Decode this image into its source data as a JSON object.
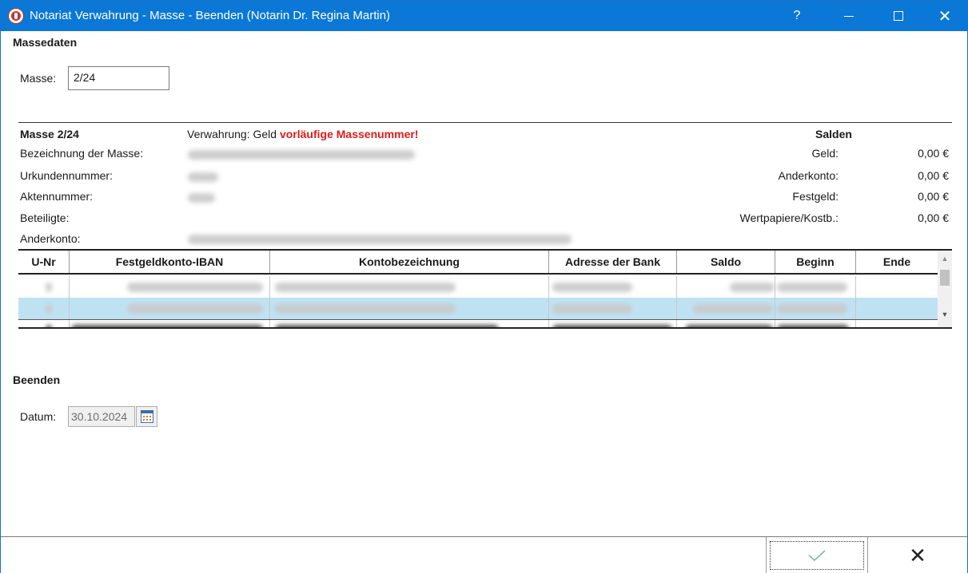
{
  "window": {
    "title": "Notariat Verwahrung - Masse - Beenden (Notarin Dr. Regina Martin)",
    "help_label": "?",
    "close_label": "✕"
  },
  "massedaten": {
    "section_title": "Massedaten",
    "masse_label": "Masse:",
    "masse_value": "2/24"
  },
  "info": {
    "masse_heading": "Masse 2/24",
    "verwahrung_label": "Verwahrung: Geld",
    "warning": "vorläufige Massenummer!",
    "fields": [
      "Bezeichnung der Masse:",
      "Urkundennummer:",
      "Aktennummer:",
      "Beteiligte:",
      "Anderkonto:"
    ],
    "salden_title": "Salden",
    "salden": [
      {
        "label": "Geld:",
        "value": "0,00 €"
      },
      {
        "label": "Anderkonto:",
        "value": "0,00 €"
      },
      {
        "label": "Festgeld:",
        "value": "0,00 €"
      },
      {
        "label": "Wertpapiere/Kostb.:",
        "value": "0,00 €"
      }
    ]
  },
  "table": {
    "columns": [
      "U-Nr",
      "Festgeldkonto-IBAN",
      "Kontobezeichnung",
      "Adresse der Bank",
      "Saldo",
      "Beginn",
      "Ende"
    ]
  },
  "beenden": {
    "section_title": "Beenden",
    "datum_label": "Datum:",
    "datum_value": "30.10.2024"
  },
  "footer": {
    "cancel_label": "✕"
  },
  "colors": {
    "titlebar": "#0b78d7",
    "warning": "#e01b1b",
    "selected_row": "#bfe2f3",
    "check": "#7fb7a3"
  }
}
